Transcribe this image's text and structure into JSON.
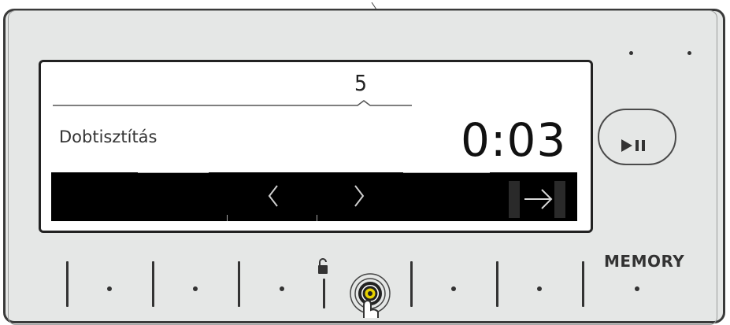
{
  "display": {
    "program_number": "5",
    "program_name": "Dobtisztítás",
    "time_remaining": "0:03"
  },
  "nav": {
    "prev_icon": "chevron-left-icon",
    "next_icon": "chevron-right-icon",
    "confirm_icon": "arrow-right-icon"
  },
  "buttons": {
    "memory_label": "MEMORY",
    "play_pause_icon": "play-pause-icon",
    "start_icon": "start-target-icon",
    "lock_icon": "unlocked-padlock-icon"
  },
  "colors": {
    "panel": "#e5e7e6",
    "screen_bg": "#ffffff",
    "nav_bar": "#000000",
    "ink": "#333333",
    "accent_yellow": "#e8d200"
  }
}
